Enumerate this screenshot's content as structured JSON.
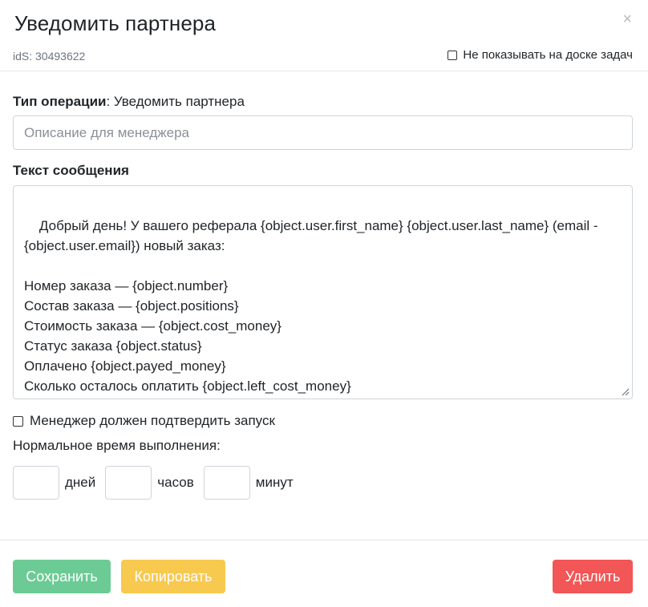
{
  "modal": {
    "title": "Уведомить партнера",
    "close_symbol": "×",
    "ids_text": "idS: 30493622",
    "hide_board_label": "Не показывать на доске задач"
  },
  "operation": {
    "type_label": "Тип операции",
    "type_value": ": Уведомить партнера"
  },
  "description_input": {
    "placeholder": "Описание для менеджера",
    "value": ""
  },
  "message": {
    "label": "Текст сообщения",
    "text": "Добрый день! У вашего реферала {object.user.first_name} {object.user.last_name} (email - {object.user.email}) новый заказ:\n\nНомер заказа — {object.number}\nСостав заказа — {object.positions}\nСтоимость заказа — {object.cost_money}\nСтатус заказа {object.status}\nОплачено {object.payed_money}\nСколько осталось оплатить {object.left_cost_money}"
  },
  "confirm_label": "Менеджер должен подтвердить запуск",
  "normal_time": {
    "label": "Нормальное время выполнения:",
    "days_label": "дней",
    "hours_label": "часов",
    "minutes_label": "минут",
    "days_value": "",
    "hours_value": "",
    "minutes_value": ""
  },
  "buttons": {
    "save": "Сохранить",
    "copy": "Копировать",
    "delete": "Удалить"
  },
  "colors": {
    "save": "#6ccb95",
    "copy": "#f7c94f",
    "delete": "#f25656"
  }
}
